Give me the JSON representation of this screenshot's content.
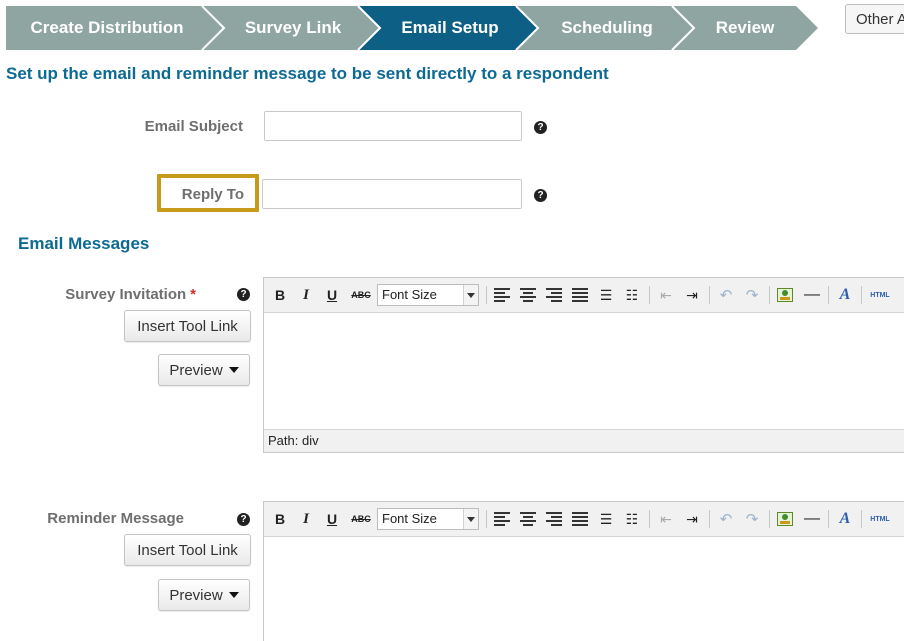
{
  "wizard": {
    "steps": [
      {
        "label": "Create Distribution",
        "active": false
      },
      {
        "label": "Survey Link",
        "active": false
      },
      {
        "label": "Email Setup",
        "active": true
      },
      {
        "label": "Scheduling",
        "active": false
      },
      {
        "label": "Review",
        "active": false
      }
    ],
    "inactive_color": "#8fa5a1",
    "active_color": "#0d5f86",
    "other_button": "Other A"
  },
  "page": {
    "title": "Set up the email and reminder message to be sent directly to a respondent"
  },
  "fields": {
    "email_subject": {
      "label": "Email Subject",
      "value": "",
      "help": "?"
    },
    "reply_to": {
      "label": "Reply To",
      "value": "",
      "help": "?"
    }
  },
  "messages": {
    "section_title": "Email Messages",
    "survey_invitation": {
      "label": "Survey Invitation",
      "required_mark": "*",
      "help": "?",
      "insert_button": "Insert Tool Link",
      "preview_button": "Preview",
      "path": "Path: div"
    },
    "reminder_message": {
      "label": "Reminder Message",
      "help": "?",
      "insert_button": "Insert Tool Link",
      "preview_button": "Preview"
    }
  },
  "toolbar": {
    "bold": "B",
    "italic": "I",
    "underline": "U",
    "strike": "ABC",
    "font_size": "Font Size",
    "html": "HTML"
  },
  "colors": {
    "heading": "#0d6a93",
    "highlight": "#c79a1a",
    "required": "#d12b2b"
  }
}
